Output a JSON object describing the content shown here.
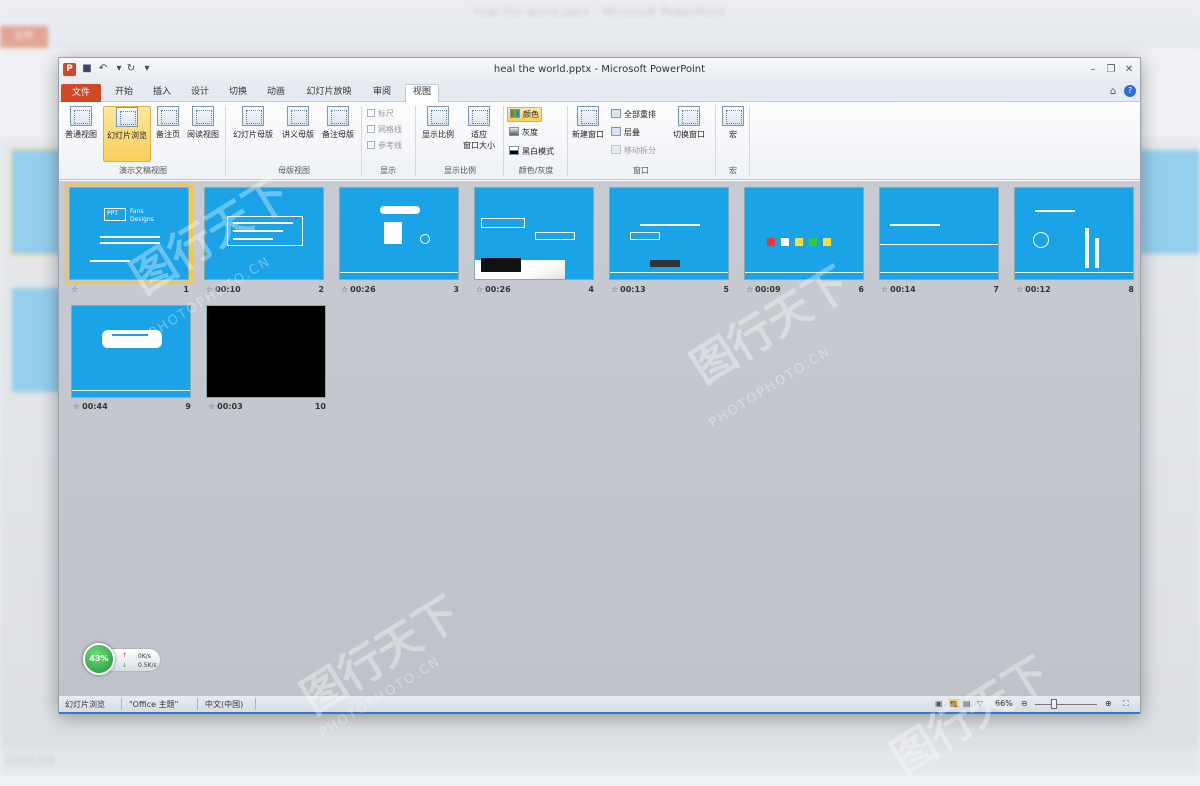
{
  "window": {
    "title": "heal the world.pptx - Microsoft PowerPoint",
    "app_icon": "P"
  },
  "tabs": [
    "文件",
    "开始",
    "插入",
    "设计",
    "切换",
    "动画",
    "幻灯片放映",
    "审阅",
    "视图"
  ],
  "ribbon": {
    "presentation_views": {
      "group_label": "演示文稿视图",
      "buttons": [
        "普通视图",
        "幻灯片浏览",
        "备注页",
        "阅读视图"
      ]
    },
    "master_views": {
      "group_label": "母版视图",
      "buttons": [
        "幻灯片母版",
        "讲义母版",
        "备注母版"
      ]
    },
    "show": {
      "group_label": "显示",
      "checks": [
        "标尺",
        "网格线",
        "参考线"
      ]
    },
    "zoom": {
      "group_label": "显示比例",
      "buttons": [
        "显示比例",
        "适应\n窗口大小"
      ]
    },
    "color": {
      "group_label": "颜色/灰度",
      "buttons": [
        "颜色",
        "灰度",
        "黑白模式"
      ]
    },
    "window": {
      "group_label": "窗口",
      "new_window": "新建窗口",
      "arrange_all": "全部重排",
      "cascade": "层叠",
      "move_split": "移动拆分",
      "switch": "切换窗口"
    },
    "macros": {
      "group_label": "宏",
      "button": "宏"
    }
  },
  "slides": [
    {
      "number": "1",
      "time": "",
      "selected": true
    },
    {
      "number": "2",
      "time": "00:10"
    },
    {
      "number": "3",
      "time": "00:26"
    },
    {
      "number": "4",
      "time": "00:26"
    },
    {
      "number": "5",
      "time": "00:13"
    },
    {
      "number": "6",
      "time": "00:09"
    },
    {
      "number": "7",
      "time": "00:14"
    },
    {
      "number": "8",
      "time": "00:12"
    },
    {
      "number": "9",
      "time": "00:44"
    },
    {
      "number": "10",
      "time": "00:03",
      "dark": true
    }
  ],
  "slide1": {
    "title_a": "PPT",
    "title_b": "Fans",
    "title_c": "Designs"
  },
  "status": {
    "view": "幻灯片浏览",
    "theme": "\"Office 主题\"",
    "language": "中文(中国)",
    "zoom": "66%"
  },
  "net_widget": {
    "percent": "43%",
    "up": "0K/s",
    "down": "0.5K/s"
  },
  "watermark": {
    "cn": "图行天下",
    "en": "PHOTOPHOTO.CN"
  },
  "colors": {
    "accent": "#d24726",
    "slide_blue": "#1aa3e6",
    "selection": "#f5c544",
    "status_blue": "#2b7cd3"
  }
}
